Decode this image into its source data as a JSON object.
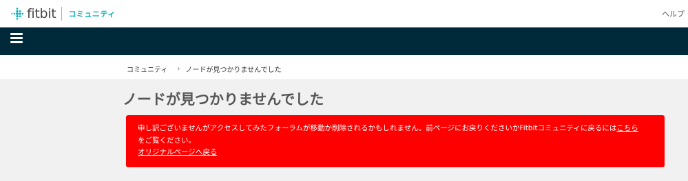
{
  "header": {
    "brand": "fitbit",
    "subtitle": "コミュニティ",
    "help": "ヘルプ"
  },
  "nav": {
    "menu_icon": "hamburger-menu-icon"
  },
  "breadcrumb": {
    "home": "コミュニティ",
    "separator": "›",
    "current": "ノードが見つかりませんでした"
  },
  "page": {
    "title": "ノードが見つかりませんでした"
  },
  "alert": {
    "message_part1": "申し訳ございませんがアクセスしてみたフォーラムが移動か削除されるかもしれません。前ページにお戻りくださいかFitbitコミュニティに戻るには",
    "link_here": "こちら",
    "message_part2": "をご覧ください。",
    "back_link": "オリジナルページへ戻る"
  },
  "colors": {
    "nav_bg": "#002a3a",
    "brand_teal": "#00b0b9",
    "alert_bg": "#ff0000"
  }
}
